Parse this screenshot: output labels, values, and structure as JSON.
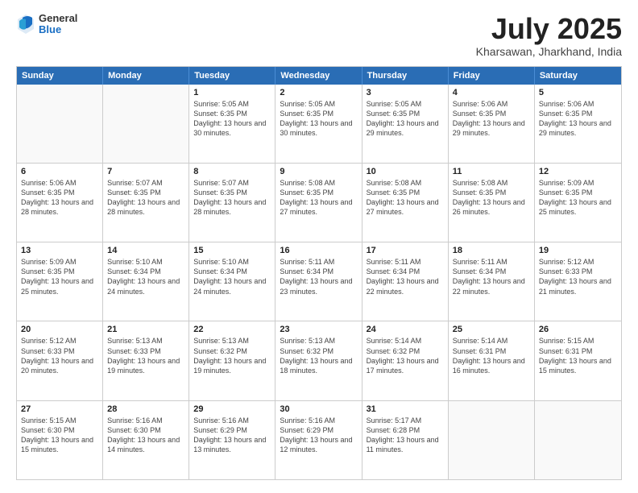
{
  "header": {
    "logo": {
      "general": "General",
      "blue": "Blue"
    },
    "title": "July 2025",
    "location": "Kharsawan, Jharkhand, India"
  },
  "calendar": {
    "days_of_week": [
      "Sunday",
      "Monday",
      "Tuesday",
      "Wednesday",
      "Thursday",
      "Friday",
      "Saturday"
    ],
    "weeks": [
      [
        {
          "day": "",
          "empty": true
        },
        {
          "day": "",
          "empty": true
        },
        {
          "day": "1",
          "sunrise": "Sunrise: 5:05 AM",
          "sunset": "Sunset: 6:35 PM",
          "daylight": "Daylight: 13 hours and 30 minutes."
        },
        {
          "day": "2",
          "sunrise": "Sunrise: 5:05 AM",
          "sunset": "Sunset: 6:35 PM",
          "daylight": "Daylight: 13 hours and 30 minutes."
        },
        {
          "day": "3",
          "sunrise": "Sunrise: 5:05 AM",
          "sunset": "Sunset: 6:35 PM",
          "daylight": "Daylight: 13 hours and 29 minutes."
        },
        {
          "day": "4",
          "sunrise": "Sunrise: 5:06 AM",
          "sunset": "Sunset: 6:35 PM",
          "daylight": "Daylight: 13 hours and 29 minutes."
        },
        {
          "day": "5",
          "sunrise": "Sunrise: 5:06 AM",
          "sunset": "Sunset: 6:35 PM",
          "daylight": "Daylight: 13 hours and 29 minutes."
        }
      ],
      [
        {
          "day": "6",
          "sunrise": "Sunrise: 5:06 AM",
          "sunset": "Sunset: 6:35 PM",
          "daylight": "Daylight: 13 hours and 28 minutes."
        },
        {
          "day": "7",
          "sunrise": "Sunrise: 5:07 AM",
          "sunset": "Sunset: 6:35 PM",
          "daylight": "Daylight: 13 hours and 28 minutes."
        },
        {
          "day": "8",
          "sunrise": "Sunrise: 5:07 AM",
          "sunset": "Sunset: 6:35 PM",
          "daylight": "Daylight: 13 hours and 28 minutes."
        },
        {
          "day": "9",
          "sunrise": "Sunrise: 5:08 AM",
          "sunset": "Sunset: 6:35 PM",
          "daylight": "Daylight: 13 hours and 27 minutes."
        },
        {
          "day": "10",
          "sunrise": "Sunrise: 5:08 AM",
          "sunset": "Sunset: 6:35 PM",
          "daylight": "Daylight: 13 hours and 27 minutes."
        },
        {
          "day": "11",
          "sunrise": "Sunrise: 5:08 AM",
          "sunset": "Sunset: 6:35 PM",
          "daylight": "Daylight: 13 hours and 26 minutes."
        },
        {
          "day": "12",
          "sunrise": "Sunrise: 5:09 AM",
          "sunset": "Sunset: 6:35 PM",
          "daylight": "Daylight: 13 hours and 25 minutes."
        }
      ],
      [
        {
          "day": "13",
          "sunrise": "Sunrise: 5:09 AM",
          "sunset": "Sunset: 6:35 PM",
          "daylight": "Daylight: 13 hours and 25 minutes."
        },
        {
          "day": "14",
          "sunrise": "Sunrise: 5:10 AM",
          "sunset": "Sunset: 6:34 PM",
          "daylight": "Daylight: 13 hours and 24 minutes."
        },
        {
          "day": "15",
          "sunrise": "Sunrise: 5:10 AM",
          "sunset": "Sunset: 6:34 PM",
          "daylight": "Daylight: 13 hours and 24 minutes."
        },
        {
          "day": "16",
          "sunrise": "Sunrise: 5:11 AM",
          "sunset": "Sunset: 6:34 PM",
          "daylight": "Daylight: 13 hours and 23 minutes."
        },
        {
          "day": "17",
          "sunrise": "Sunrise: 5:11 AM",
          "sunset": "Sunset: 6:34 PM",
          "daylight": "Daylight: 13 hours and 22 minutes."
        },
        {
          "day": "18",
          "sunrise": "Sunrise: 5:11 AM",
          "sunset": "Sunset: 6:34 PM",
          "daylight": "Daylight: 13 hours and 22 minutes."
        },
        {
          "day": "19",
          "sunrise": "Sunrise: 5:12 AM",
          "sunset": "Sunset: 6:33 PM",
          "daylight": "Daylight: 13 hours and 21 minutes."
        }
      ],
      [
        {
          "day": "20",
          "sunrise": "Sunrise: 5:12 AM",
          "sunset": "Sunset: 6:33 PM",
          "daylight": "Daylight: 13 hours and 20 minutes."
        },
        {
          "day": "21",
          "sunrise": "Sunrise: 5:13 AM",
          "sunset": "Sunset: 6:33 PM",
          "daylight": "Daylight: 13 hours and 19 minutes."
        },
        {
          "day": "22",
          "sunrise": "Sunrise: 5:13 AM",
          "sunset": "Sunset: 6:32 PM",
          "daylight": "Daylight: 13 hours and 19 minutes."
        },
        {
          "day": "23",
          "sunrise": "Sunrise: 5:13 AM",
          "sunset": "Sunset: 6:32 PM",
          "daylight": "Daylight: 13 hours and 18 minutes."
        },
        {
          "day": "24",
          "sunrise": "Sunrise: 5:14 AM",
          "sunset": "Sunset: 6:32 PM",
          "daylight": "Daylight: 13 hours and 17 minutes."
        },
        {
          "day": "25",
          "sunrise": "Sunrise: 5:14 AM",
          "sunset": "Sunset: 6:31 PM",
          "daylight": "Daylight: 13 hours and 16 minutes."
        },
        {
          "day": "26",
          "sunrise": "Sunrise: 5:15 AM",
          "sunset": "Sunset: 6:31 PM",
          "daylight": "Daylight: 13 hours and 15 minutes."
        }
      ],
      [
        {
          "day": "27",
          "sunrise": "Sunrise: 5:15 AM",
          "sunset": "Sunset: 6:30 PM",
          "daylight": "Daylight: 13 hours and 15 minutes."
        },
        {
          "day": "28",
          "sunrise": "Sunrise: 5:16 AM",
          "sunset": "Sunset: 6:30 PM",
          "daylight": "Daylight: 13 hours and 14 minutes."
        },
        {
          "day": "29",
          "sunrise": "Sunrise: 5:16 AM",
          "sunset": "Sunset: 6:29 PM",
          "daylight": "Daylight: 13 hours and 13 minutes."
        },
        {
          "day": "30",
          "sunrise": "Sunrise: 5:16 AM",
          "sunset": "Sunset: 6:29 PM",
          "daylight": "Daylight: 13 hours and 12 minutes."
        },
        {
          "day": "31",
          "sunrise": "Sunrise: 5:17 AM",
          "sunset": "Sunset: 6:28 PM",
          "daylight": "Daylight: 13 hours and 11 minutes."
        },
        {
          "day": "",
          "empty": true
        },
        {
          "day": "",
          "empty": true
        }
      ]
    ]
  }
}
